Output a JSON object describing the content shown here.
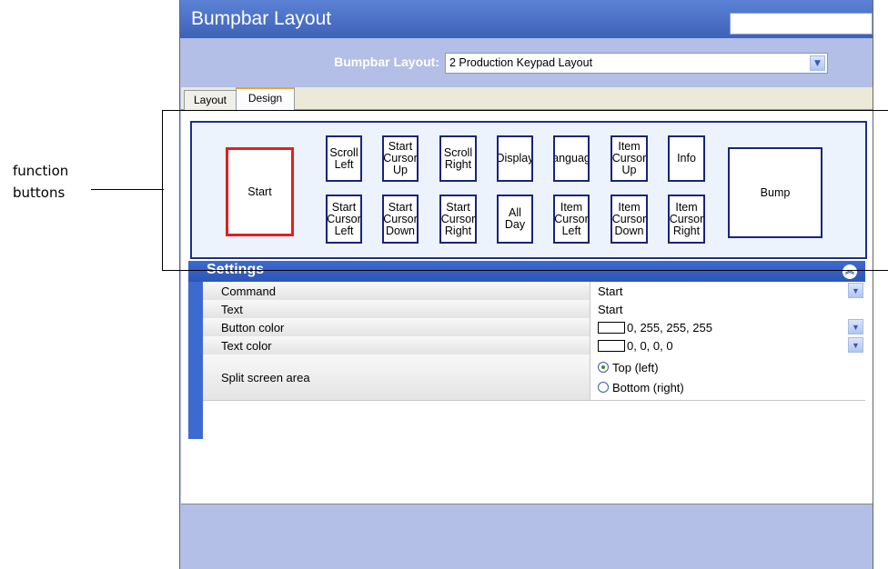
{
  "annotation": {
    "label_line1": "function",
    "label_line2": "buttons"
  },
  "window": {
    "title": "Bumpbar Layout"
  },
  "layout_selector": {
    "label": "Bumpbar Layout:",
    "value": "2 Production Keypad Layout"
  },
  "tabs": [
    {
      "label": "Layout"
    },
    {
      "label": "Design"
    }
  ],
  "function_buttons": {
    "start": "Start",
    "top": [
      "Scroll Left",
      "Start Cursor Up",
      "Scroll Right",
      "Display",
      "Language",
      "Item Cursor Up",
      "Info"
    ],
    "bottom": [
      "Start Cursor Left",
      "Start Cursor Down",
      "Start Cursor Right",
      "All Day",
      "Item Cursor Left",
      "Item Cursor Down",
      "Item Cursor Right"
    ],
    "bump": "Bump"
  },
  "settings": {
    "title": "Settings",
    "rows": [
      {
        "key": "Command",
        "value": "Start"
      },
      {
        "key": "Text",
        "value": "Start"
      },
      {
        "key": "Button color",
        "value": "0, 255, 255, 255"
      },
      {
        "key": "Text color",
        "value": "0, 0, 0, 0"
      },
      {
        "key": "Split screen area"
      }
    ],
    "split_options": [
      {
        "label": "Top (left)",
        "selected": true
      },
      {
        "label": "Bottom (right)",
        "selected": false
      }
    ]
  },
  "colors": {
    "title_bar": "#4a70c8",
    "accent_border": "#1a237e",
    "selected_border": "#e41e1e",
    "window_bg": "#b3bfe7"
  }
}
